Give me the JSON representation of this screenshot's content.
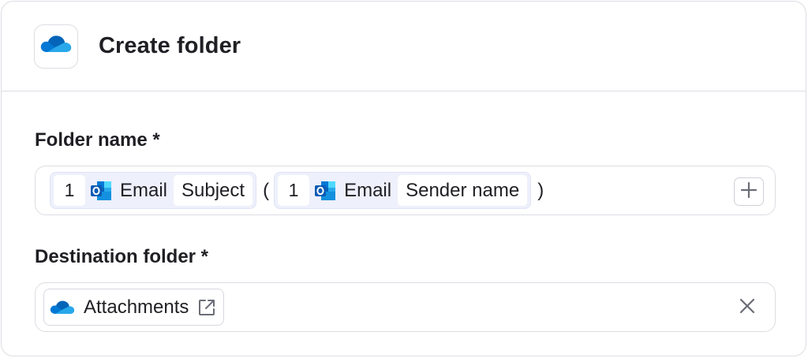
{
  "header": {
    "title": "Create folder",
    "app_icon": "onedrive-cloud-icon"
  },
  "folder_name": {
    "label": "Folder name *",
    "tokens": [
      {
        "step": "1",
        "app": "Email",
        "app_icon": "outlook-icon",
        "field": "Subject"
      },
      {
        "step": "1",
        "app": "Email",
        "app_icon": "outlook-icon",
        "field": "Sender name"
      }
    ],
    "open_paren": "(",
    "close_paren": ")",
    "add_icon": "plus-icon"
  },
  "destination_folder": {
    "label": "Destination folder *",
    "value": "Attachments",
    "value_icon": "onedrive-cloud-icon",
    "open_icon": "external-link-icon",
    "clear_icon": "close-icon"
  },
  "colors": {
    "onedrive_blue": "#0f78d4",
    "outlook_blue": "#0a64c9",
    "token_bg": "#eef0fb",
    "border": "#dcdde3"
  }
}
